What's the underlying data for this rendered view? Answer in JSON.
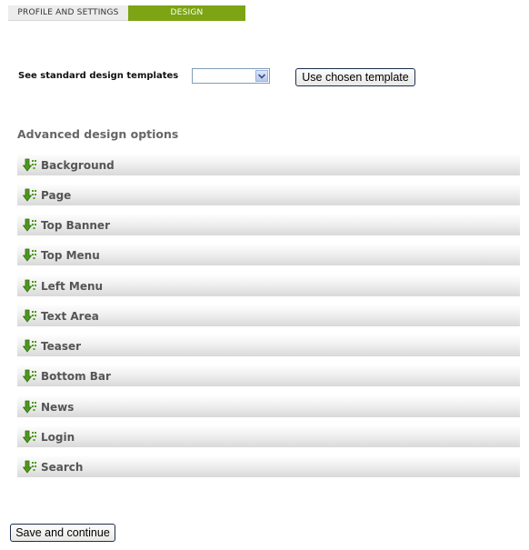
{
  "tabs": [
    {
      "label": "PROFILE AND SETTINGS"
    },
    {
      "label": "DESIGN"
    }
  ],
  "templates": {
    "label": "See standard design templates",
    "selected": "",
    "button_label": "Use chosen template"
  },
  "advanced": {
    "title": "Advanced design options",
    "options": [
      {
        "label": "Background"
      },
      {
        "label": "Page"
      },
      {
        "label": "Top Banner"
      },
      {
        "label": "Top Menu"
      },
      {
        "label": "Left Menu"
      },
      {
        "label": "Text Area"
      },
      {
        "label": "Teaser"
      },
      {
        "label": "Bottom Bar"
      },
      {
        "label": "News"
      },
      {
        "label": "Login"
      },
      {
        "label": "Search"
      }
    ]
  },
  "footer": {
    "save_label": "Save and continue"
  },
  "colors": {
    "accent": "#7ca414",
    "icon_green": "#4e9a1c"
  },
  "icons": {
    "option_icon": "expand-down-arrow-icon",
    "select_icon": "chevron-down-icon"
  }
}
